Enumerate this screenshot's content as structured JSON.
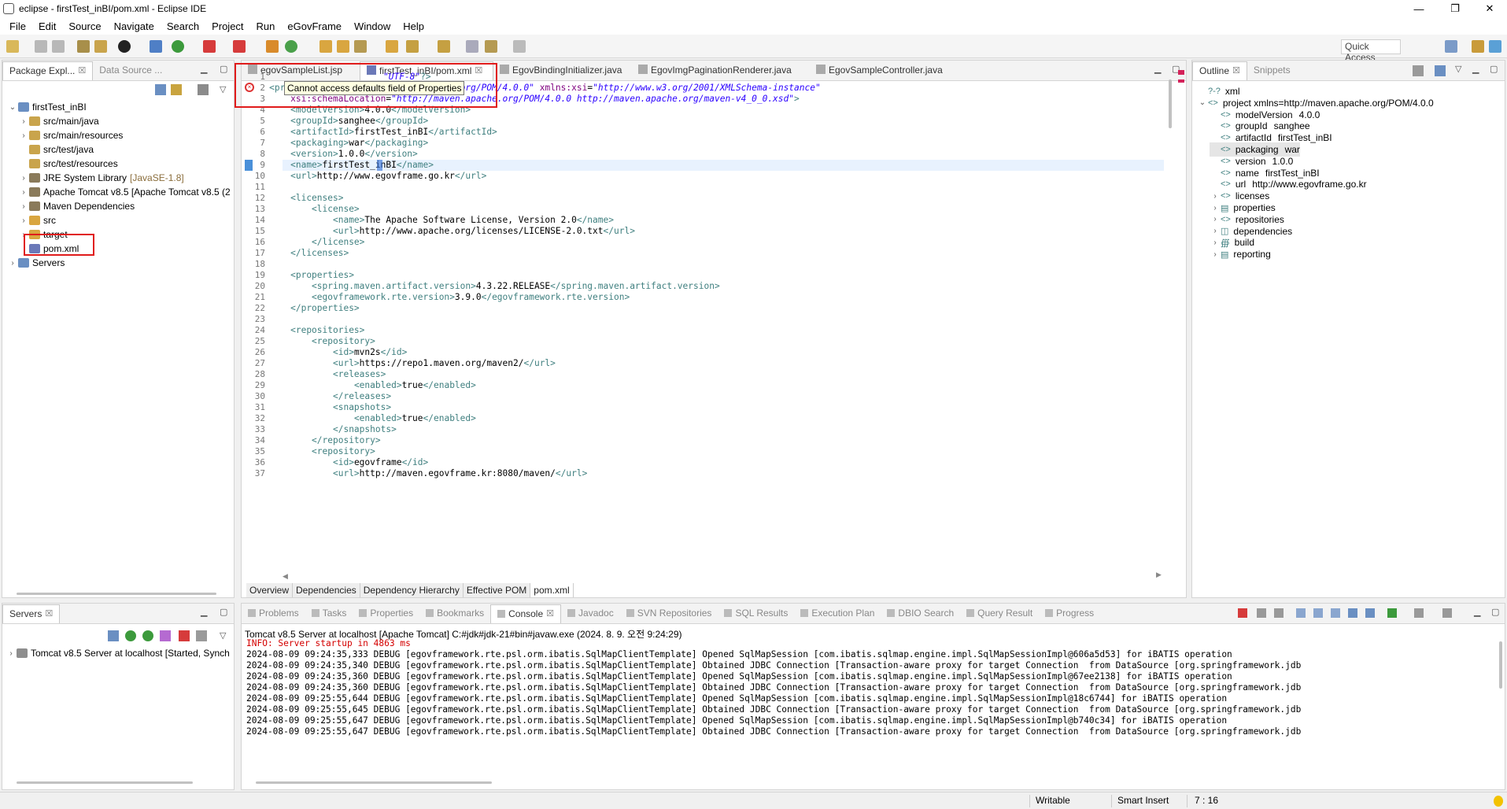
{
  "window": {
    "title": "eclipse - firstTest_inBI/pom.xml - Eclipse IDE",
    "minimize": "—",
    "restore": "❐",
    "close": "✕"
  },
  "menu": [
    "File",
    "Edit",
    "Source",
    "Navigate",
    "Search",
    "Project",
    "Run",
    "eGovFrame",
    "Window",
    "Help"
  ],
  "toolbar": {
    "quick_access": "Quick Access"
  },
  "left_view": {
    "tabs": [
      {
        "label": "Package Expl...",
        "close": "☒"
      },
      {
        "label": "Data Source ...",
        "close": ""
      }
    ],
    "tree": [
      {
        "label": "firstTest_inBI",
        "arrow": "⌄",
        "deco": ""
      },
      {
        "label": "src/main/java",
        "arrow": "›",
        "deco": ""
      },
      {
        "label": "src/main/resources",
        "arrow": "›",
        "deco": ""
      },
      {
        "label": "src/test/java",
        "arrow": "",
        "deco": ""
      },
      {
        "label": "src/test/resources",
        "arrow": "",
        "deco": ""
      },
      {
        "label": "JRE System Library",
        "arrow": "›",
        "deco": "[JavaSE-1.8]"
      },
      {
        "label": "Apache Tomcat v8.5 [Apache Tomcat v8.5 (2",
        "arrow": "›",
        "deco": ""
      },
      {
        "label": "Maven Dependencies",
        "arrow": "›",
        "deco": ""
      },
      {
        "label": "src",
        "arrow": "›",
        "deco": ""
      },
      {
        "label": "target",
        "arrow": "›",
        "deco": ""
      },
      {
        "label": "pom.xml",
        "arrow": "",
        "deco": ""
      },
      {
        "label": "Servers",
        "arrow": "›",
        "deco": ""
      }
    ]
  },
  "editor": {
    "tabs": [
      {
        "label": "egovSampleList.jsp"
      },
      {
        "label": "firstTest_inBI/pom.xml",
        "close": "☒"
      },
      {
        "label": "EgovBindingInitializer.java"
      },
      {
        "label": "EgovImgPaginationRenderer.java"
      },
      {
        "label": "EgovSampleController.java"
      }
    ],
    "tooltip": "Cannot access defaults field of Properties",
    "line_numbers": [
      "1",
      "2",
      "3",
      "4",
      "5",
      "6",
      "7",
      "8",
      "9",
      "10",
      "11",
      "12",
      "13",
      "14",
      "15",
      "16",
      "17",
      "18",
      "19",
      "20",
      "21",
      "22",
      "23",
      "24",
      "25",
      "26",
      "27",
      "28",
      "29",
      "30",
      "31",
      "32",
      "33",
      "34",
      "35",
      "36",
      "37"
    ],
    "lines": [
      [
        [
          "str",
          "\"UTF-8\""
        ],
        [
          "tag",
          "?>"
        ]
      ],
      [
        [
          "tag",
          "<project "
        ],
        [
          "attr",
          "xmlns"
        ],
        [
          "txt",
          "="
        ],
        [
          "str",
          "\"http://maven.apache.org/POM/4.0.0\""
        ],
        [
          "txt",
          " "
        ],
        [
          "attr",
          "xmlns:xsi"
        ],
        [
          "txt",
          "="
        ],
        [
          "str",
          "\"http://www.w3.org/2001/XMLSchema-instance\""
        ]
      ],
      [
        [
          "txt",
          "    "
        ],
        [
          "attr",
          "xsi:schemaLocation"
        ],
        [
          "txt",
          "="
        ],
        [
          "str",
          "\"http://maven.apache.org/POM/4.0.0 http://maven.apache.org/maven-v4_0_0.xsd\""
        ],
        [
          "tag",
          ">"
        ]
      ],
      [
        [
          "txt",
          "    "
        ],
        [
          "tag",
          "<modelVersion>"
        ],
        [
          "txt",
          "4.0.0"
        ],
        [
          "tag",
          "</modelVersion>"
        ]
      ],
      [
        [
          "txt",
          "    "
        ],
        [
          "tag",
          "<groupId>"
        ],
        [
          "txt",
          "sanghee"
        ],
        [
          "tag",
          "</groupId>"
        ]
      ],
      [
        [
          "txt",
          "    "
        ],
        [
          "tag",
          "<artifactId>"
        ],
        [
          "txt",
          "firstTest_inBI"
        ],
        [
          "tag",
          "</artifactId>"
        ]
      ],
      [
        [
          "txt",
          "    "
        ],
        [
          "tag",
          "<packaging>"
        ],
        [
          "txt",
          "war"
        ],
        [
          "tag",
          "</packaging>"
        ]
      ],
      [
        [
          "txt",
          "    "
        ],
        [
          "tag",
          "<version>"
        ],
        [
          "txt",
          "1.0.0"
        ],
        [
          "tag",
          "</version>"
        ]
      ],
      [
        [
          "txt",
          "    "
        ],
        [
          "tag",
          "<name>"
        ],
        [
          "txt",
          "firstTest_inBI"
        ],
        [
          "tag",
          "</name>"
        ]
      ],
      [
        [
          "txt",
          "    "
        ],
        [
          "tag",
          "<url>"
        ],
        [
          "txt",
          "http://www.egovframe.go.kr"
        ],
        [
          "tag",
          "</url>"
        ]
      ],
      [],
      [
        [
          "txt",
          "    "
        ],
        [
          "tag",
          "<licenses>"
        ]
      ],
      [
        [
          "txt",
          "        "
        ],
        [
          "tag",
          "<license>"
        ]
      ],
      [
        [
          "txt",
          "            "
        ],
        [
          "tag",
          "<name>"
        ],
        [
          "txt",
          "The Apache Software License, Version 2.0"
        ],
        [
          "tag",
          "</name>"
        ]
      ],
      [
        [
          "txt",
          "            "
        ],
        [
          "tag",
          "<url>"
        ],
        [
          "txt",
          "http://www.apache.org/licenses/LICENSE-2.0.txt"
        ],
        [
          "tag",
          "</url>"
        ]
      ],
      [
        [
          "txt",
          "        "
        ],
        [
          "tag",
          "</license>"
        ]
      ],
      [
        [
          "txt",
          "    "
        ],
        [
          "tag",
          "</licenses>"
        ]
      ],
      [],
      [
        [
          "txt",
          "    "
        ],
        [
          "tag",
          "<properties>"
        ]
      ],
      [
        [
          "txt",
          "        "
        ],
        [
          "tag",
          "<spring.maven.artifact.version>"
        ],
        [
          "txt",
          "4.3.22.RELEASE"
        ],
        [
          "tag",
          "</spring.maven.artifact.version>"
        ]
      ],
      [
        [
          "txt",
          "        "
        ],
        [
          "tag",
          "<egovframework.rte.version>"
        ],
        [
          "txt",
          "3.9.0"
        ],
        [
          "tag",
          "</egovframework.rte.version>"
        ]
      ],
      [
        [
          "txt",
          "    "
        ],
        [
          "tag",
          "</properties>"
        ]
      ],
      [],
      [
        [
          "txt",
          "    "
        ],
        [
          "tag",
          "<repositories>"
        ]
      ],
      [
        [
          "txt",
          "        "
        ],
        [
          "tag",
          "<repository>"
        ]
      ],
      [
        [
          "txt",
          "            "
        ],
        [
          "tag",
          "<id>"
        ],
        [
          "txt",
          "mvn2s"
        ],
        [
          "tag",
          "</id>"
        ]
      ],
      [
        [
          "txt",
          "            "
        ],
        [
          "tag",
          "<url>"
        ],
        [
          "txt",
          "https://repo1.maven.org/maven2/"
        ],
        [
          "tag",
          "</url>"
        ]
      ],
      [
        [
          "txt",
          "            "
        ],
        [
          "tag",
          "<releases>"
        ]
      ],
      [
        [
          "txt",
          "                "
        ],
        [
          "tag",
          "<enabled>"
        ],
        [
          "txt",
          "true"
        ],
        [
          "tag",
          "</enabled>"
        ]
      ],
      [
        [
          "txt",
          "            "
        ],
        [
          "tag",
          "</releases>"
        ]
      ],
      [
        [
          "txt",
          "            "
        ],
        [
          "tag",
          "<snapshots>"
        ]
      ],
      [
        [
          "txt",
          "                "
        ],
        [
          "tag",
          "<enabled>"
        ],
        [
          "txt",
          "true"
        ],
        [
          "tag",
          "</enabled>"
        ]
      ],
      [
        [
          "txt",
          "            "
        ],
        [
          "tag",
          "</snapshots>"
        ]
      ],
      [
        [
          "txt",
          "        "
        ],
        [
          "tag",
          "</repository>"
        ]
      ],
      [
        [
          "txt",
          "        "
        ],
        [
          "tag",
          "<repository>"
        ]
      ],
      [
        [
          "txt",
          "            "
        ],
        [
          "tag",
          "<id>"
        ],
        [
          "txt",
          "egovframe"
        ],
        [
          "tag",
          "</id>"
        ]
      ],
      [
        [
          "txt",
          "            "
        ],
        [
          "tag",
          "<url>"
        ],
        [
          "txt",
          "http://maven.egovframe.kr:8080/maven/"
        ],
        [
          "tag",
          "</url>"
        ]
      ]
    ],
    "bottom_tabs": [
      "Overview",
      "Dependencies",
      "Dependency Hierarchy",
      "Effective POM",
      "pom.xml"
    ]
  },
  "outline": {
    "tabs": [
      {
        "label": "Outline",
        "close": "☒"
      },
      {
        "label": "Snippets"
      }
    ],
    "items": [
      {
        "label": "xml",
        "value": "",
        "level": 0,
        "arrow": "",
        "icon": "?-?"
      },
      {
        "label": "project xmlns=http://maven.apache.org/POM/4.0.0",
        "value": "",
        "level": 0,
        "arrow": "⌄",
        "icon": "<>"
      },
      {
        "label": "modelVersion",
        "value": "4.0.0",
        "level": 1,
        "arrow": "",
        "icon": "<>"
      },
      {
        "label": "groupId",
        "value": "sanghee",
        "level": 1,
        "arrow": "",
        "icon": "<>"
      },
      {
        "label": "artifactId",
        "value": "firstTest_inBI",
        "level": 1,
        "arrow": "",
        "icon": "<>"
      },
      {
        "label": "packaging",
        "value": "war",
        "level": 1,
        "arrow": "",
        "icon": "<>",
        "selected": true
      },
      {
        "label": "version",
        "value": "1.0.0",
        "level": 1,
        "arrow": "",
        "icon": "<>"
      },
      {
        "label": "name",
        "value": "firstTest_inBI",
        "level": 1,
        "arrow": "",
        "icon": "<>"
      },
      {
        "label": "url",
        "value": "http://www.egovframe.go.kr",
        "level": 1,
        "arrow": "",
        "icon": "<>"
      },
      {
        "label": "licenses",
        "value": "",
        "level": 1,
        "arrow": "›",
        "icon": "<>"
      },
      {
        "label": "properties",
        "value": "",
        "level": 1,
        "arrow": "›",
        "icon": "▤"
      },
      {
        "label": "repositories",
        "value": "",
        "level": 1,
        "arrow": "›",
        "icon": "<>"
      },
      {
        "label": "dependencies",
        "value": "",
        "level": 1,
        "arrow": "›",
        "icon": "◫"
      },
      {
        "label": "build",
        "value": "",
        "level": 1,
        "arrow": "›",
        "icon": "∰"
      },
      {
        "label": "reporting",
        "value": "",
        "level": 1,
        "arrow": "›",
        "icon": "▤"
      }
    ]
  },
  "servers_view": {
    "tab": "Servers",
    "close": "☒",
    "item": "Tomcat v8.5 Server at localhost  [Started, Synch"
  },
  "console": {
    "tabs": [
      "Problems",
      "Tasks",
      "Properties",
      "Bookmarks",
      "Console",
      "Javadoc",
      "SVN Repositories",
      "SQL Results",
      "Execution Plan",
      "DBIO Search",
      "Query Result",
      "Progress"
    ],
    "active_tab": "Console",
    "close": "☒",
    "header": "Tomcat v8.5 Server at localhost [Apache Tomcat] C:#jdk#jdk-21#bin#javaw.exe (2024. 8. 9. 오전 9:24:29)",
    "lines": [
      {
        "text": "INFO: Server startup in 4863 ms",
        "color": "#d40000"
      },
      {
        "text": "2024-08-09 09:24:35,333 DEBUG [egovframework.rte.psl.orm.ibatis.SqlMapClientTemplate] Opened SqlMapSession [com.ibatis.sqlmap.engine.impl.SqlMapSessionImpl@606a5d53] for iBATIS operation",
        "color": "#000"
      },
      {
        "text": "2024-08-09 09:24:35,340 DEBUG [egovframework.rte.psl.orm.ibatis.SqlMapClientTemplate] Obtained JDBC Connection [Transaction-aware proxy for target Connection  from DataSource [org.springframework.jdb",
        "color": "#000"
      },
      {
        "text": "2024-08-09 09:24:35,360 DEBUG [egovframework.rte.psl.orm.ibatis.SqlMapClientTemplate] Opened SqlMapSession [com.ibatis.sqlmap.engine.impl.SqlMapSessionImpl@67ee2138] for iBATIS operation",
        "color": "#000"
      },
      {
        "text": "2024-08-09 09:24:35,360 DEBUG [egovframework.rte.psl.orm.ibatis.SqlMapClientTemplate] Obtained JDBC Connection [Transaction-aware proxy for target Connection  from DataSource [org.springframework.jdb",
        "color": "#000"
      },
      {
        "text": "2024-08-09 09:25:55,644 DEBUG [egovframework.rte.psl.orm.ibatis.SqlMapClientTemplate] Opened SqlMapSession [com.ibatis.sqlmap.engine.impl.SqlMapSessionImpl@18c6744] for iBATIS operation",
        "color": "#000"
      },
      {
        "text": "2024-08-09 09:25:55,645 DEBUG [egovframework.rte.psl.orm.ibatis.SqlMapClientTemplate] Obtained JDBC Connection [Transaction-aware proxy for target Connection  from DataSource [org.springframework.jdb",
        "color": "#000"
      },
      {
        "text": "2024-08-09 09:25:55,647 DEBUG [egovframework.rte.psl.orm.ibatis.SqlMapClientTemplate] Opened SqlMapSession [com.ibatis.sqlmap.engine.impl.SqlMapSessionImpl@b740c34] for iBATIS operation",
        "color": "#000"
      },
      {
        "text": "2024-08-09 09:25:55,647 DEBUG [egovframework.rte.psl.orm.ibatis.SqlMapClientTemplate] Obtained JDBC Connection [Transaction-aware proxy for target Connection  from DataSource [org.springframework.jdb",
        "color": "#000"
      }
    ]
  },
  "status": {
    "mode": "Writable",
    "insert": "Smart Insert",
    "position": "7 : 16"
  },
  "colors": {
    "highlight_box": "#e01b1b",
    "selection": "#e8f2fe",
    "current_line": "#e8f2fe"
  }
}
